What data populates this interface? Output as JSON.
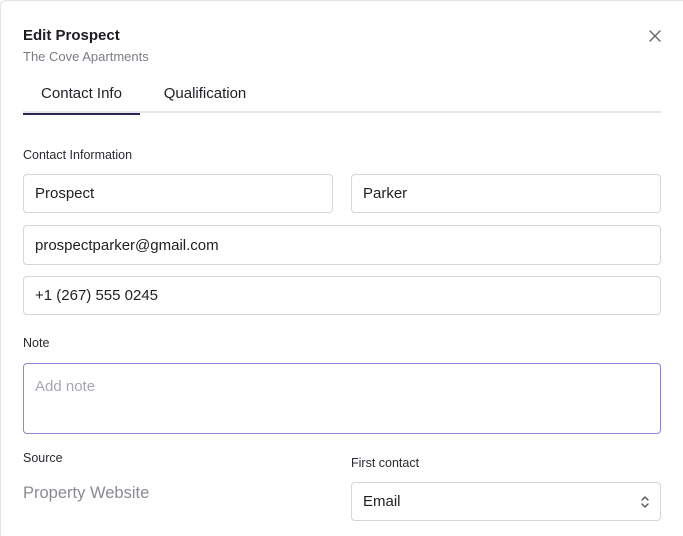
{
  "modal": {
    "title": "Edit Prospect",
    "subtitle": "The Cove Apartments"
  },
  "tabs": [
    {
      "label": "Contact Info",
      "active": true
    },
    {
      "label": "Qualification",
      "active": false
    }
  ],
  "contact": {
    "section_label": "Contact Information",
    "first_name": "Prospect",
    "last_name": "Parker",
    "email": "prospectparker@gmail.com",
    "phone": "+1 (267) 555 0245"
  },
  "note": {
    "label": "Note",
    "placeholder": "Add note",
    "value": ""
  },
  "source": {
    "label": "Source",
    "value": "Property Website"
  },
  "first_contact": {
    "label": "First contact",
    "value": "Email"
  },
  "colors": {
    "active_tab_underline": "#2b2652",
    "note_focus_border": "#8f86d9"
  },
  "icons": {
    "close": "close-icon",
    "select": "chevron-updown-icon"
  }
}
